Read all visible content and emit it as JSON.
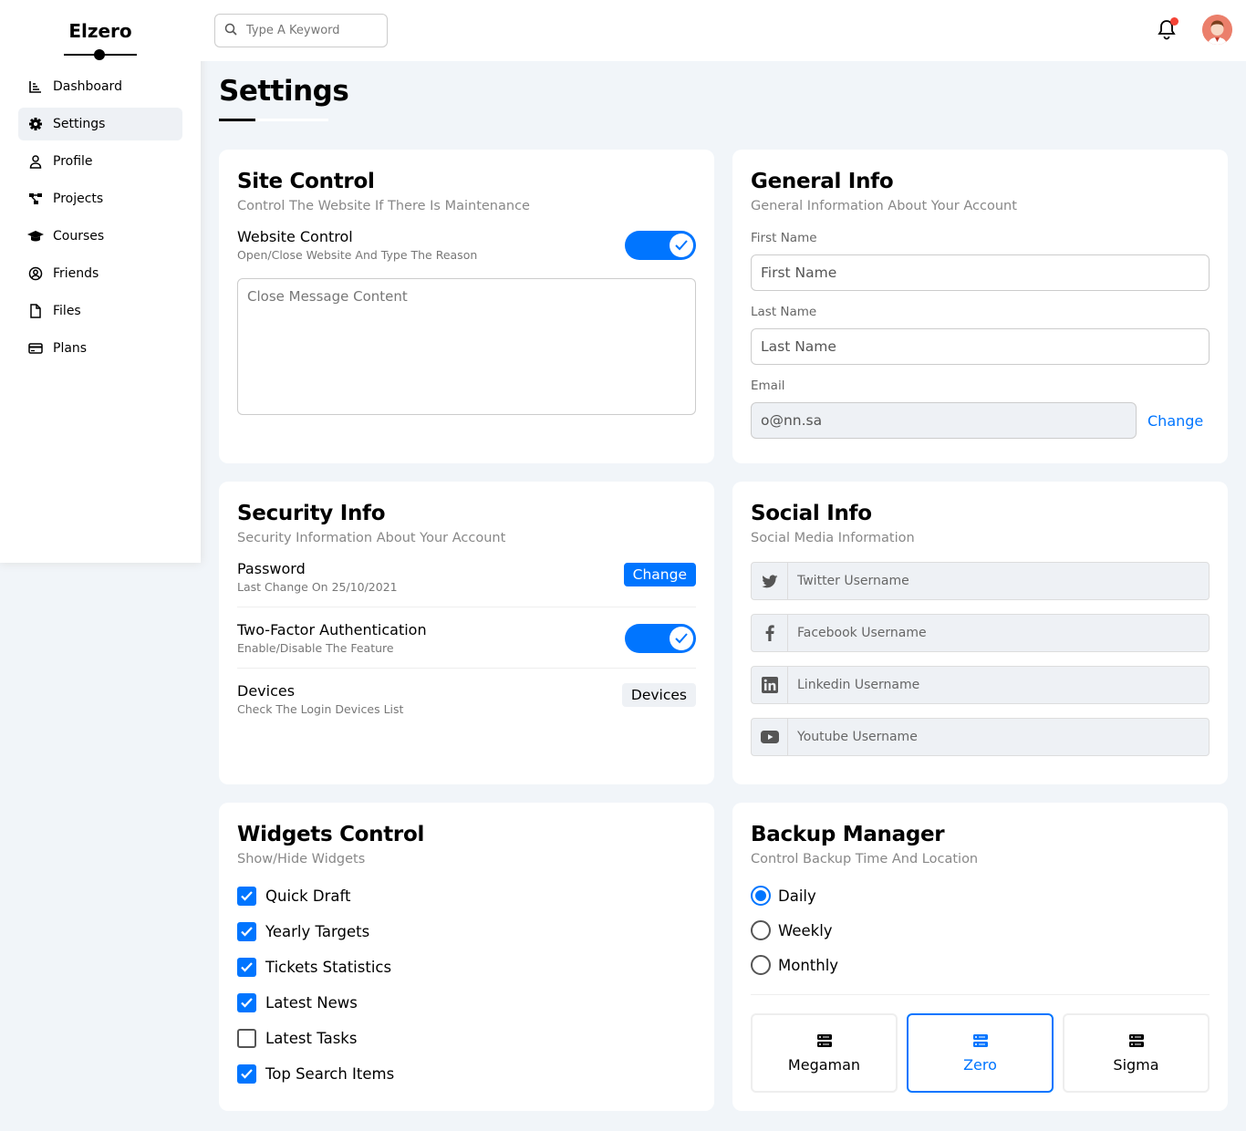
{
  "sidebar": {
    "logo": "Elzero",
    "items": [
      {
        "label": "Dashboard",
        "icon": "chart-icon"
      },
      {
        "label": "Settings",
        "icon": "gear-icon"
      },
      {
        "label": "Profile",
        "icon": "user-icon"
      },
      {
        "label": "Projects",
        "icon": "diagram-icon"
      },
      {
        "label": "Courses",
        "icon": "graduation-cap-icon"
      },
      {
        "label": "Friends",
        "icon": "user-circle-icon"
      },
      {
        "label": "Files",
        "icon": "file-icon"
      },
      {
        "label": "Plans",
        "icon": "credit-card-icon"
      }
    ],
    "active_index": 1
  },
  "header": {
    "search_placeholder": "Type A Keyword",
    "has_notification": true
  },
  "page": {
    "title": "Settings"
  },
  "site_control": {
    "title": "Site Control",
    "subtitle": "Control The Website If There Is Maintenance",
    "website_control_label": "Website Control",
    "website_control_desc": "Open/Close Website And Type The Reason",
    "website_control_on": true,
    "message_placeholder": "Close Message Content"
  },
  "general_info": {
    "title": "General Info",
    "subtitle": "General Information About Your Account",
    "first_name_label": "First Name",
    "first_name_placeholder": "First Name",
    "last_name_label": "Last Name",
    "last_name_placeholder": "Last Name",
    "email_label": "Email",
    "email_value": "o@nn.sa",
    "change_label": "Change"
  },
  "security_info": {
    "title": "Security Info",
    "subtitle": "Security Information About Your Account",
    "password_label": "Password",
    "password_desc": "Last Change On 25/10/2021",
    "password_button": "Change",
    "twofa_label": "Two-Factor Authentication",
    "twofa_desc": "Enable/Disable The Feature",
    "twofa_on": true,
    "devices_label": "Devices",
    "devices_desc": "Check The Login Devices List",
    "devices_button": "Devices"
  },
  "social_info": {
    "title": "Social Info",
    "subtitle": "Social Media Information",
    "fields": [
      {
        "icon": "twitter-icon",
        "placeholder": "Twitter Username"
      },
      {
        "icon": "facebook-icon",
        "placeholder": "Facebook Username"
      },
      {
        "icon": "linkedin-icon",
        "placeholder": "Linkedin Username"
      },
      {
        "icon": "youtube-icon",
        "placeholder": "Youtube Username"
      }
    ]
  },
  "widgets_control": {
    "title": "Widgets Control",
    "subtitle": "Show/Hide Widgets",
    "items": [
      {
        "label": "Quick Draft",
        "checked": true
      },
      {
        "label": "Yearly Targets",
        "checked": true
      },
      {
        "label": "Tickets Statistics",
        "checked": true
      },
      {
        "label": "Latest News",
        "checked": true
      },
      {
        "label": "Latest Tasks",
        "checked": false
      },
      {
        "label": "Top Search Items",
        "checked": true
      }
    ]
  },
  "backup_manager": {
    "title": "Backup Manager",
    "subtitle": "Control Backup Time And Location",
    "options": [
      {
        "label": "Daily",
        "selected": true
      },
      {
        "label": "Weekly",
        "selected": false
      },
      {
        "label": "Monthly",
        "selected": false
      }
    ],
    "servers": [
      {
        "label": "Megaman",
        "active": false
      },
      {
        "label": "Zero",
        "active": true
      },
      {
        "label": "Sigma",
        "active": false
      }
    ]
  },
  "colors": {
    "accent": "#0075ff",
    "background": "#f1f5f9",
    "notification": "#f44336"
  }
}
